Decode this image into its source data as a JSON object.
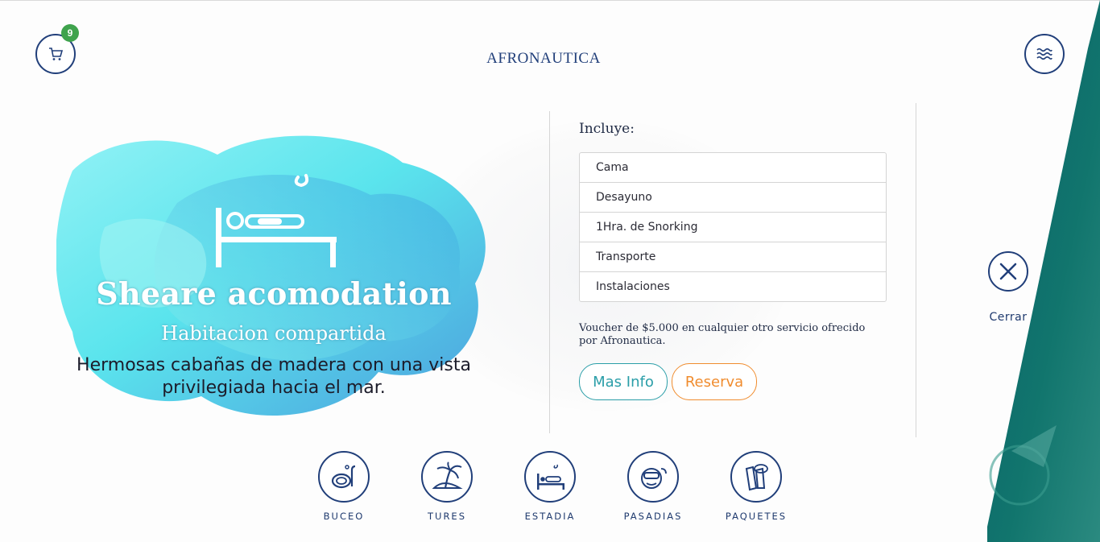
{
  "brand": {
    "logo_text": "AFRONAUTICA"
  },
  "cart": {
    "count": "9"
  },
  "hero": {
    "title": "Sheare acomodation",
    "subtitle": "Habitacion compartida",
    "description_line1": "Hermosas cabañas de madera con una vista",
    "description_line2": "privilegiada hacia el mar."
  },
  "includes": {
    "title": "Incluye:",
    "items": [
      "Cama",
      "Desayuno",
      "1Hra. de Snorking",
      "Transporte",
      "Instalaciones"
    ],
    "voucher": "Voucher de $5.000 en cualquier otro servicio ofrecido por Afronautica."
  },
  "actions": {
    "more_info": "Mas Info",
    "reserve": "Reserva"
  },
  "close": {
    "label": "Cerrar"
  },
  "nav": [
    {
      "label": "BUCEO",
      "icon": "snorkel-mask-icon"
    },
    {
      "label": "TURES",
      "icon": "palm-tree-icon"
    },
    {
      "label": "ESTADIA",
      "icon": "bed-icon"
    },
    {
      "label": "PASADIAS",
      "icon": "diver-face-icon"
    },
    {
      "label": "PAQUETES",
      "icon": "fins-icon"
    }
  ],
  "colors": {
    "navy": "#213f7a",
    "teal": "#2a9ea8",
    "orange": "#f08c2e",
    "badge": "#3fa34d",
    "slab": "#0f6f6a"
  }
}
